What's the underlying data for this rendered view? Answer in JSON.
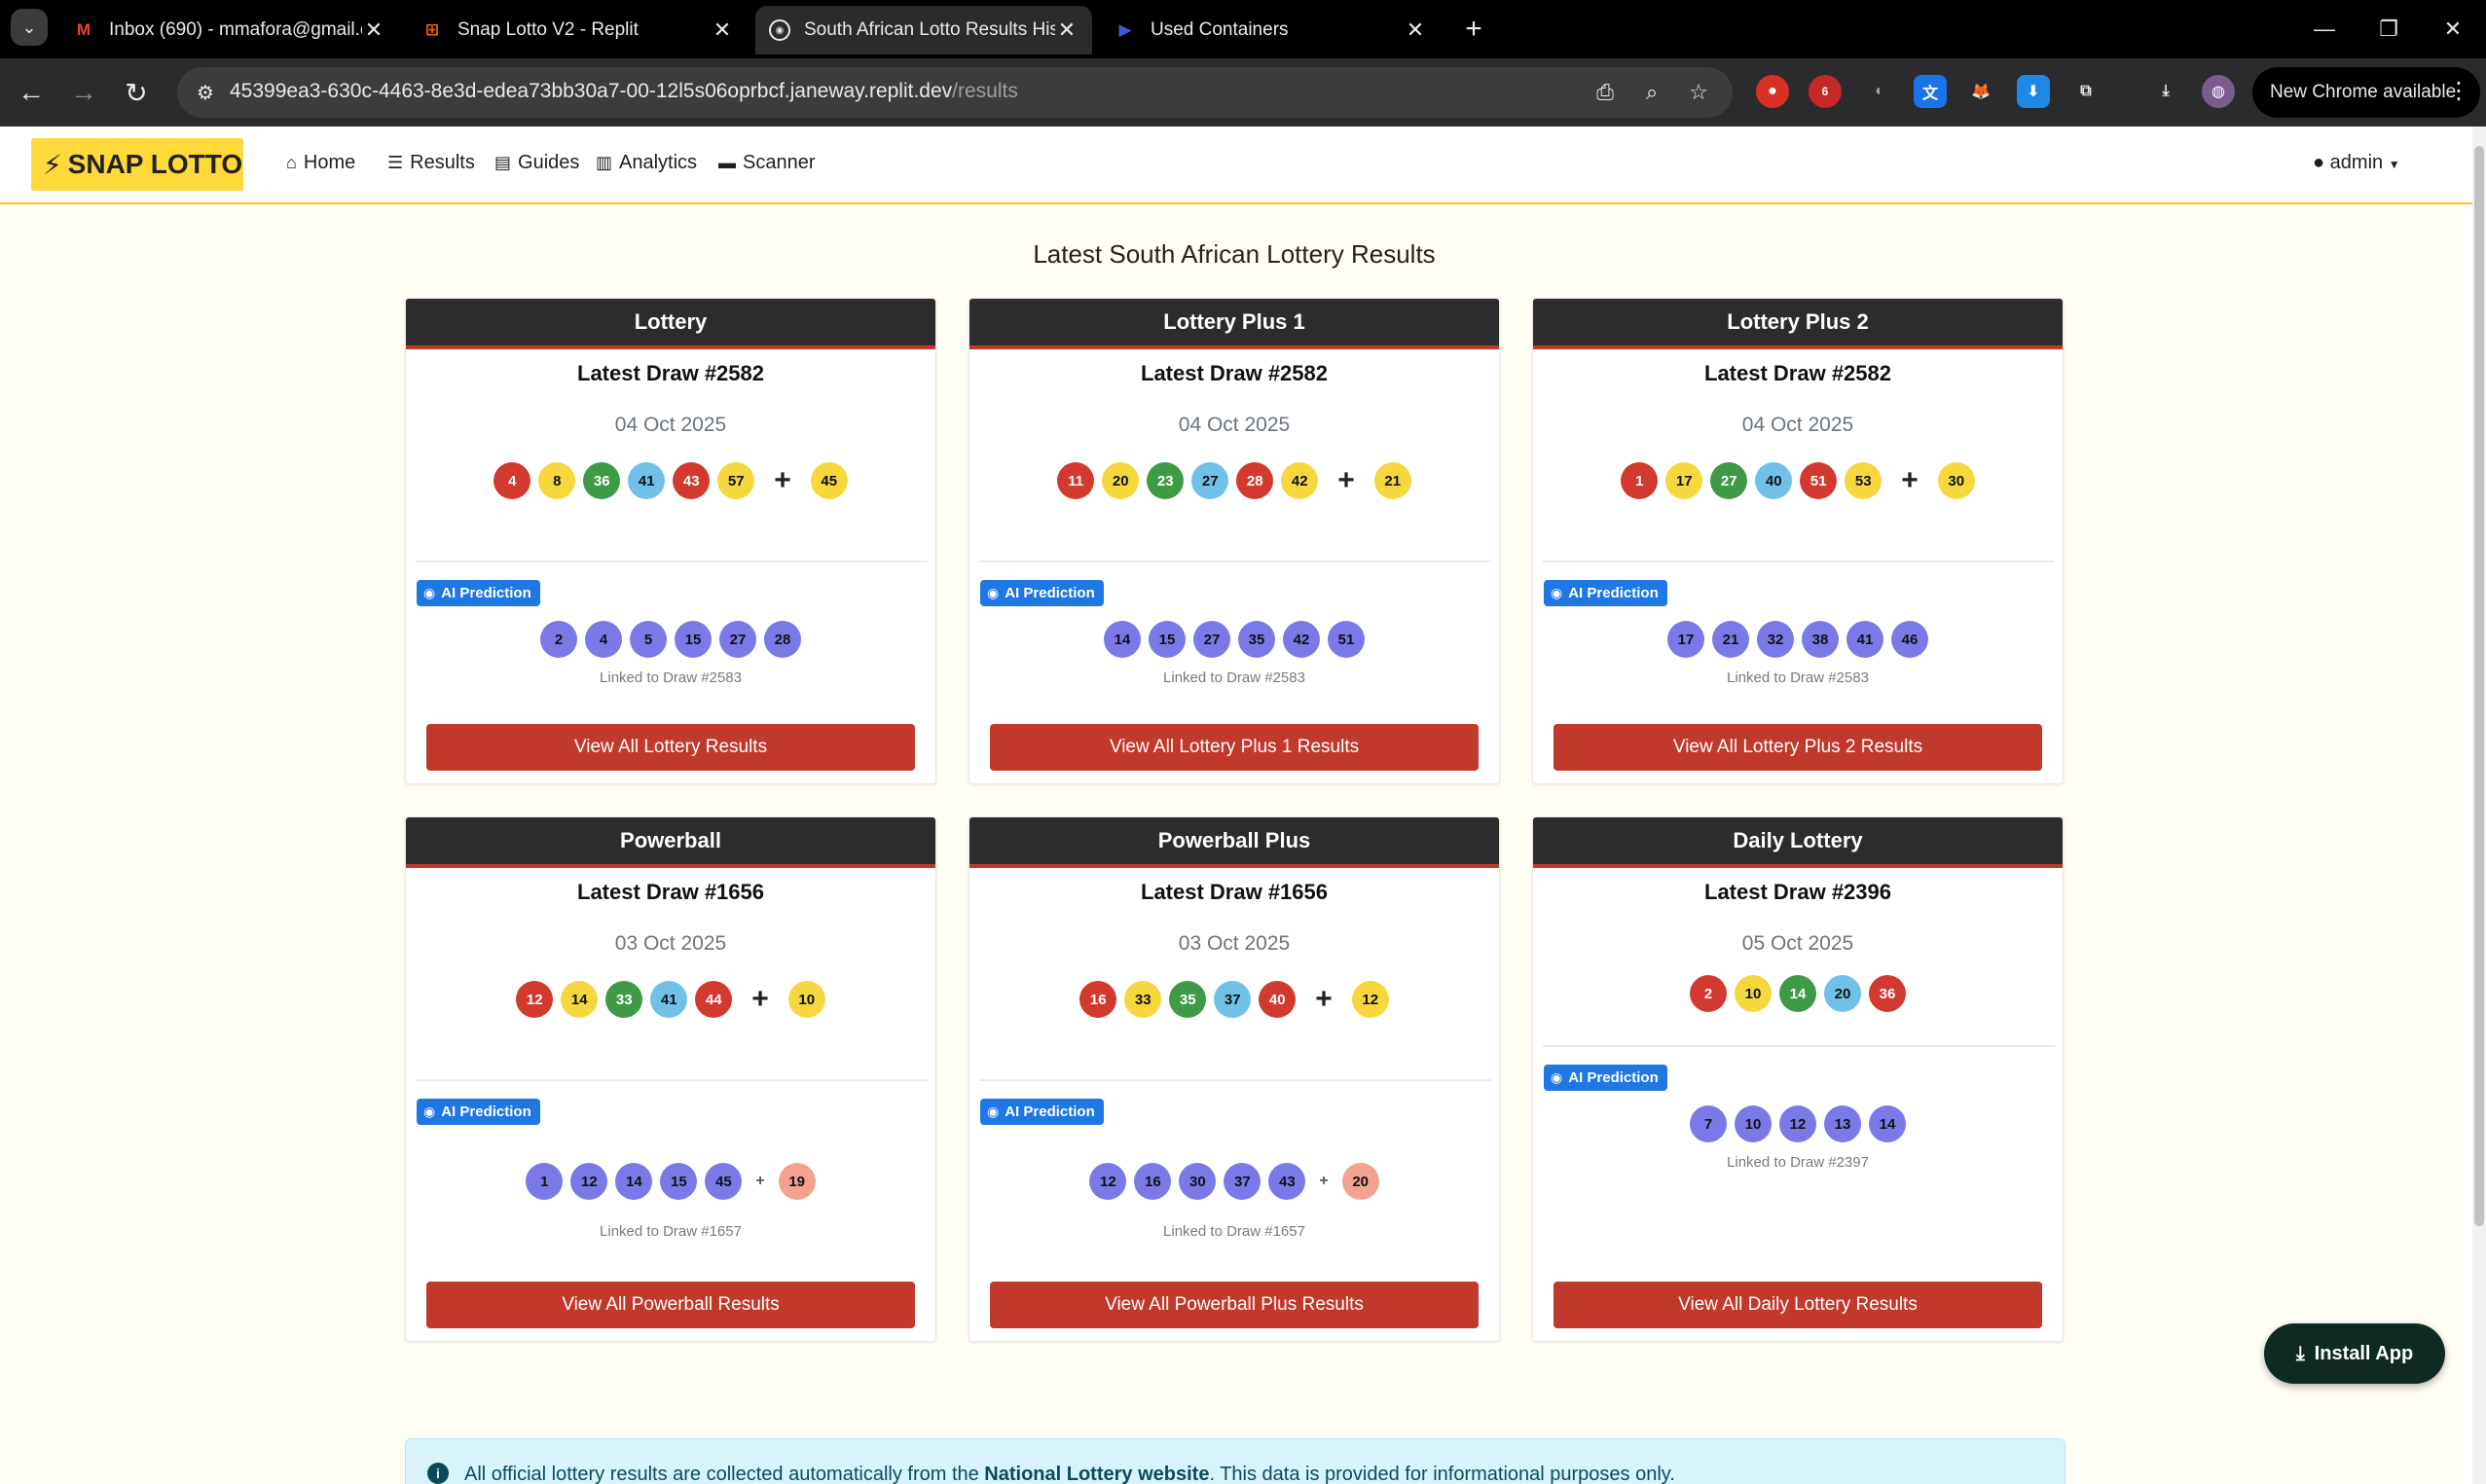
{
  "browser": {
    "tabs": [
      {
        "title": "Inbox (690) - mmafora@gmail.c",
        "icon": "gmail-icon",
        "active": false
      },
      {
        "title": "Snap Lotto V2 - Replit",
        "icon": "replit-icon",
        "active": false
      },
      {
        "title": "South African Lotto Results Hist",
        "icon": "site-icon",
        "active": true
      },
      {
        "title": "Used Containers",
        "icon": "containers-icon",
        "active": false
      }
    ],
    "url_host": "45399ea3-630c-4463-8e3d-edea73bb30a7-00-12l5s06oprbcf.janeway.replit.dev",
    "url_path": "/results",
    "new_chrome": "New Chrome available",
    "ext_badge": "6"
  },
  "nav": {
    "brand": "SNAP LOTTO",
    "links": [
      "Home",
      "Results",
      "Guides",
      "Analytics",
      "Scanner"
    ],
    "user": "admin"
  },
  "page": {
    "title": "Latest South African Lottery Results"
  },
  "cards": [
    {
      "name": "Lottery",
      "draw": "Latest Draw #2582",
      "date": "04 Oct 2025",
      "balls": [
        {
          "n": "4",
          "c": "red"
        },
        {
          "n": "8",
          "c": "yellow"
        },
        {
          "n": "36",
          "c": "green"
        },
        {
          "n": "41",
          "c": "blue"
        },
        {
          "n": "43",
          "c": "red"
        },
        {
          "n": "57",
          "c": "yellow"
        }
      ],
      "bonus": {
        "n": "45",
        "c": "yellow"
      },
      "ai_label": "AI Prediction",
      "prediction": [
        "2",
        "4",
        "5",
        "15",
        "27",
        "28"
      ],
      "pred_bonus": null,
      "linked": "Linked to Draw #2583",
      "button": "View All Lottery Results"
    },
    {
      "name": "Lottery Plus 1",
      "draw": "Latest Draw #2582",
      "date": "04 Oct 2025",
      "balls": [
        {
          "n": "11",
          "c": "red"
        },
        {
          "n": "20",
          "c": "yellow"
        },
        {
          "n": "23",
          "c": "green"
        },
        {
          "n": "27",
          "c": "blue"
        },
        {
          "n": "28",
          "c": "red"
        },
        {
          "n": "42",
          "c": "yellow"
        }
      ],
      "bonus": {
        "n": "21",
        "c": "yellow"
      },
      "ai_label": "AI Prediction",
      "prediction": [
        "14",
        "15",
        "27",
        "35",
        "42",
        "51"
      ],
      "pred_bonus": null,
      "linked": "Linked to Draw #2583",
      "button": "View All Lottery Plus 1 Results"
    },
    {
      "name": "Lottery Plus 2",
      "draw": "Latest Draw #2582",
      "date": "04 Oct 2025",
      "balls": [
        {
          "n": "1",
          "c": "red"
        },
        {
          "n": "17",
          "c": "yellow"
        },
        {
          "n": "27",
          "c": "green"
        },
        {
          "n": "40",
          "c": "blue"
        },
        {
          "n": "51",
          "c": "red"
        },
        {
          "n": "53",
          "c": "yellow"
        }
      ],
      "bonus": {
        "n": "30",
        "c": "yellow"
      },
      "ai_label": "AI Prediction",
      "prediction": [
        "17",
        "21",
        "32",
        "38",
        "41",
        "46"
      ],
      "pred_bonus": null,
      "linked": "Linked to Draw #2583",
      "button": "View All Lottery Plus 2 Results"
    },
    {
      "name": "Powerball",
      "draw": "Latest Draw #1656",
      "date": "03 Oct 2025",
      "balls": [
        {
          "n": "12",
          "c": "red"
        },
        {
          "n": "14",
          "c": "yellow"
        },
        {
          "n": "33",
          "c": "green"
        },
        {
          "n": "41",
          "c": "blue"
        },
        {
          "n": "44",
          "c": "red"
        }
      ],
      "bonus": {
        "n": "10",
        "c": "yellow"
      },
      "ai_label": "AI Prediction",
      "prediction": [
        "1",
        "12",
        "14",
        "15",
        "45"
      ],
      "pred_bonus": "19",
      "linked": "Linked to Draw #1657",
      "button": "View All Powerball Results"
    },
    {
      "name": "Powerball Plus",
      "draw": "Latest Draw #1656",
      "date": "03 Oct 2025",
      "balls": [
        {
          "n": "16",
          "c": "red"
        },
        {
          "n": "33",
          "c": "yellow"
        },
        {
          "n": "35",
          "c": "green"
        },
        {
          "n": "37",
          "c": "blue"
        },
        {
          "n": "40",
          "c": "red"
        }
      ],
      "bonus": {
        "n": "12",
        "c": "yellow"
      },
      "ai_label": "AI Prediction",
      "prediction": [
        "12",
        "16",
        "30",
        "37",
        "43"
      ],
      "pred_bonus": "20",
      "linked": "Linked to Draw #1657",
      "button": "View All Powerball Plus Results"
    },
    {
      "name": "Daily Lottery",
      "draw": "Latest Draw #2396",
      "date": "05 Oct 2025",
      "balls": [
        {
          "n": "2",
          "c": "red"
        },
        {
          "n": "10",
          "c": "yellow"
        },
        {
          "n": "14",
          "c": "green"
        },
        {
          "n": "20",
          "c": "blue"
        },
        {
          "n": "36",
          "c": "red"
        }
      ],
      "bonus": null,
      "ai_label": "AI Prediction",
      "prediction": [
        "7",
        "10",
        "12",
        "13",
        "14"
      ],
      "pred_bonus": null,
      "linked": "Linked to Draw #2397",
      "button": "View All Daily Lottery Results"
    }
  ],
  "install_label": "Install App",
  "info": {
    "pre": "All official lottery results are collected automatically from the ",
    "link": "National Lottery website",
    "post": ". This data is provided for informational purposes only."
  }
}
